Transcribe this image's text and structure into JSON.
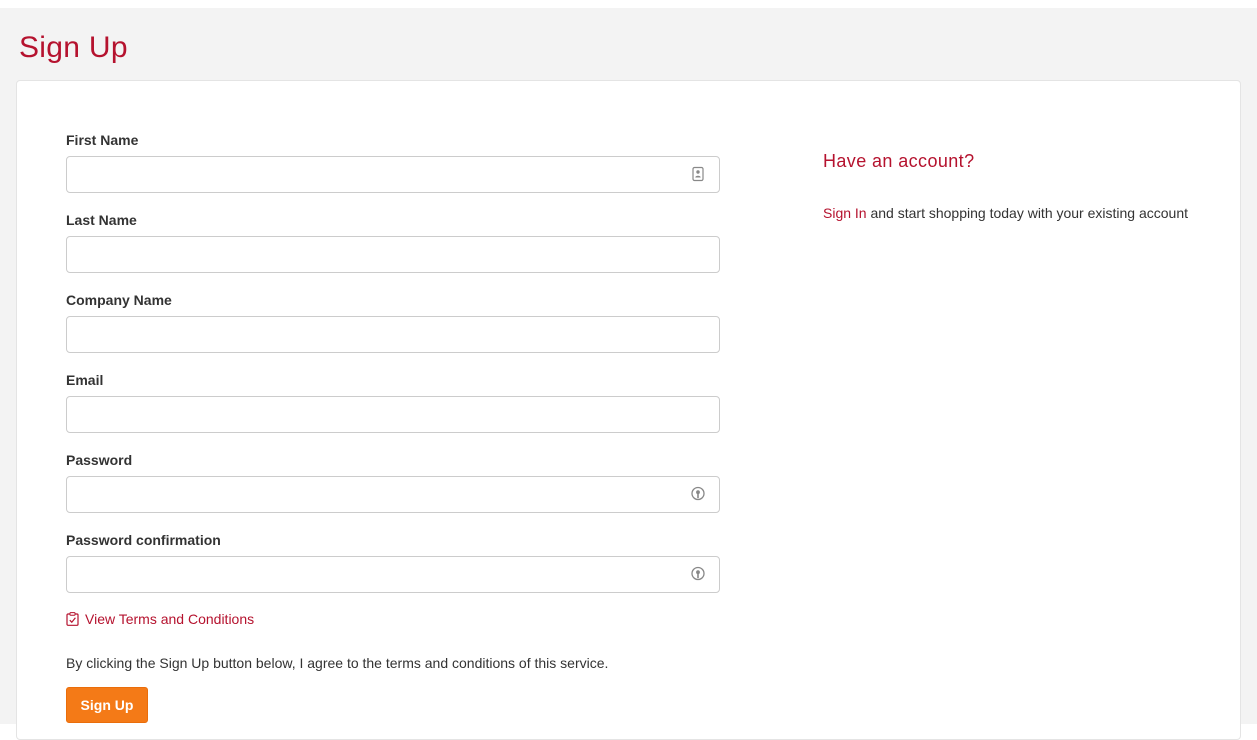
{
  "page": {
    "title": "Sign Up"
  },
  "form": {
    "fields": [
      {
        "label": "First Name",
        "value": "",
        "placeholder": "",
        "icon": "contact-card-icon"
      },
      {
        "label": "Last Name",
        "value": "",
        "placeholder": ""
      },
      {
        "label": "Company Name",
        "value": "",
        "placeholder": ""
      },
      {
        "label": "Email",
        "value": "",
        "placeholder": ""
      },
      {
        "label": "Password",
        "value": "",
        "placeholder": "",
        "icon": "password-key-icon"
      },
      {
        "label": "Password confirmation",
        "value": "",
        "placeholder": "",
        "icon": "password-key-icon"
      }
    ],
    "terms_link": "View Terms and Conditions",
    "agreement_text": "By clicking the Sign Up button below, I agree to the terms and conditions of this service.",
    "submit_label": "Sign Up"
  },
  "sidebar": {
    "heading": "Have an account?",
    "signin_link": "Sign In",
    "signin_text": " and start shopping today with your existing account"
  },
  "colors": {
    "brand": "#b5122e",
    "button": "#f47a17",
    "page_background": "#f3f3f3",
    "border": "#cccccc"
  }
}
